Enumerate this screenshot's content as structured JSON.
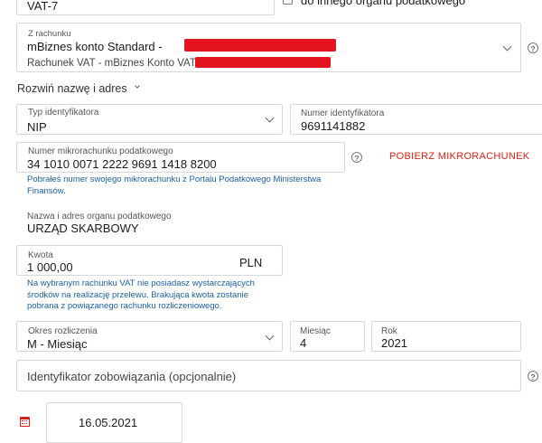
{
  "form_type": {
    "value": "VAT-7"
  },
  "other_office": {
    "checkbox_label": "do innego organu podatkowego"
  },
  "account": {
    "label": "Z rachunku",
    "name_prefix": "mBiznes konto Standard -",
    "vat_prefix": "Rachunek VAT - mBiznes Konto VAT"
  },
  "expand_name_address": "Rozwiń nazwę i adres",
  "identifier_type": {
    "label": "Typ identyfikatora",
    "value": "NIP"
  },
  "identifier_number": {
    "label": "Numer identyfikatora",
    "value": "9691141882"
  },
  "micro_account": {
    "label": "Numer mikrorachunku podatkowego",
    "value": "34 1010 0071 2222 9691 1418 8200",
    "hint": "Pobrałeś numer swojego mikrorachunku z Portalu Podatkowego Ministerstwa Finansów.",
    "fetch_button": "POBIERZ MIKRORACHUNEK"
  },
  "tax_office": {
    "label": "Nazwa i adres organu podatkowego",
    "value": "URZĄD SKARBOWY"
  },
  "amount": {
    "label": "Kwota",
    "value": "1 000,00",
    "currency": "PLN",
    "hint": "Na wybranym rachunku VAT nie posiadasz wystarczających środków na realizację przelewu. Brakująca kwota zostanie pobrana z powiązanego rachunku rozliczeniowego."
  },
  "period": {
    "label": "Okres rozliczenia",
    "value": "M - Miesiąc"
  },
  "month": {
    "label": "Miesiąc",
    "value": "4"
  },
  "year": {
    "label": "Rok",
    "value": "2021"
  },
  "obligation_id": {
    "placeholder": "Identyfikator zobowiązania (opcjonalnie)"
  },
  "date": {
    "value": "16.05.2021"
  },
  "colors": {
    "accent_red": "#d4231b",
    "hint_blue": "#1c5e9e",
    "border": "#d8d8d8"
  }
}
